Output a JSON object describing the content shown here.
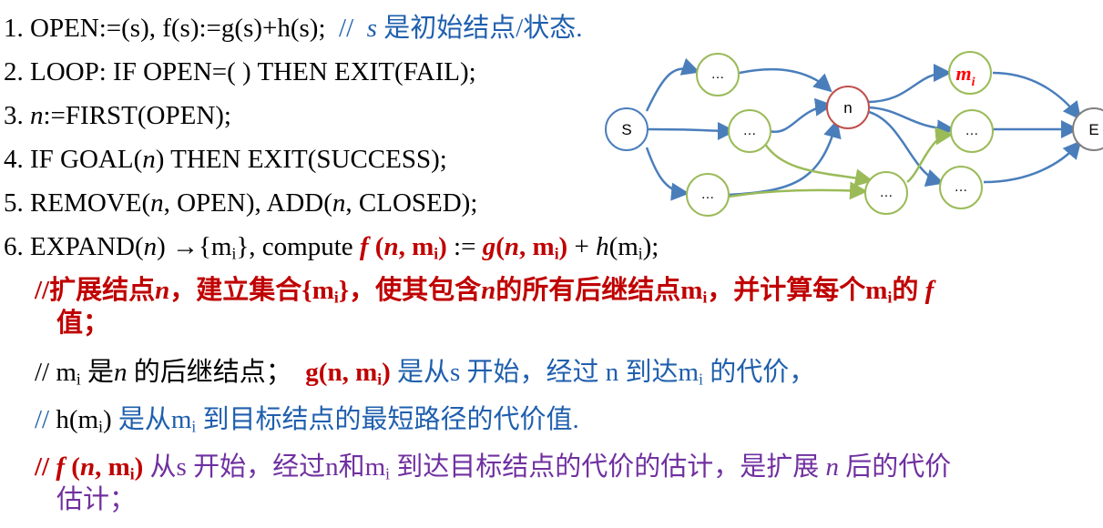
{
  "algorithm": {
    "l1_num": "1.",
    "l1_code": "OPEN:=(s), f(s):=g(s)+h(s);",
    "l1_comment_slash": "//",
    "l1_comment_s": "s",
    "l1_comment_text": "是初始结点/状态.",
    "l2": "2. LOOP: IF OPEN=( ) THEN EXIT(FAIL);",
    "l3_num": "3.",
    "l3_n": "n",
    "l3_rest": ":=FIRST(OPEN);",
    "l4_a": "4. IF GOAL(",
    "l4_n": "n",
    "l4_b": ") THEN EXIT(SUCCESS);",
    "l5_a": "5. REMOVE(",
    "l5_n1": "n",
    "l5_b": ", OPEN),  ADD(",
    "l5_n2": "n",
    "l5_c": ", CLOSED);",
    "l6_a": "6. EXPAND(",
    "l6_n": "n",
    "l6_b": ") →{m",
    "l6_sub1": "i",
    "l6_c": "}, compute ",
    "l6_f": "f",
    "l6_d": " (",
    "l6_n2": "n",
    "l6_e": ", m",
    "l6_sub2": "i",
    "l6_f2": ")",
    "l6_g": " := ",
    "l6_gfun": "g",
    "l6_h": "(",
    "l6_n3": "n",
    "l6_i": ", m",
    "l6_sub3": "i",
    "l6_j": ")",
    "l6_k": " + ",
    "l6_hfun": "h",
    "l6_l": "(m",
    "l6_sub4": "i",
    "l6_m": ");"
  },
  "comments": {
    "c1_a": "//扩展结点",
    "c1_n": "n",
    "c1_b": "，建立集合{m",
    "c1_sub1": "i",
    "c1_c": "}，使其包含",
    "c1_n2": "n",
    "c1_d": "的所有后继结点m",
    "c1_sub2": "i",
    "c1_e": "，并计算每个m",
    "c1_sub3": "i",
    "c1_f": "的",
    "c1_fvar": "f",
    "c1_line2": "值；",
    "c2_a": "// m",
    "c2_sub1": "i",
    "c2_b": " 是",
    "c2_n": "n",
    "c2_c": " 的后继结点；",
    "c2_g": "g(n, m",
    "c2_sub2": "i",
    "c2_g2": ")",
    "c2_d": " 是从s 开始，经过 n 到达m",
    "c2_sub3": "i",
    "c2_e": " 的代价，",
    "c3_a": "// ",
    "c3_h": "h(m",
    "c3_sub1": "i",
    "c3_h2": ")",
    "c3_b": " 是从m",
    "c3_sub2": "i",
    "c3_c": " 到目标结点的最短路径的代价值.",
    "c4_a": "//",
    "c4_f": "f",
    "c4_b": " (",
    "c4_n": "n",
    "c4_c": ", m",
    "c4_sub1": "i",
    "c4_d": ")",
    "c4_e": " 从s 开始，经过n和m",
    "c4_sub2": "i",
    "c4_f2": " 到达目标结点的代价的估计，是扩展 ",
    "c4_n2": "n",
    "c4_g": " 后的代价",
    "c4_line2": "估计；"
  },
  "diagram": {
    "node_s": "S",
    "node_n": "n",
    "node_mi": "m",
    "node_mi_sub": "i",
    "node_e": "E",
    "ellipsis": "…",
    "colors": {
      "blue_edge": "#4a7ebb",
      "green_edge": "#9bbb59",
      "red_node": "#c0504d",
      "gray_node": "#7f7f7f",
      "mi_text": "#ff0000"
    }
  }
}
